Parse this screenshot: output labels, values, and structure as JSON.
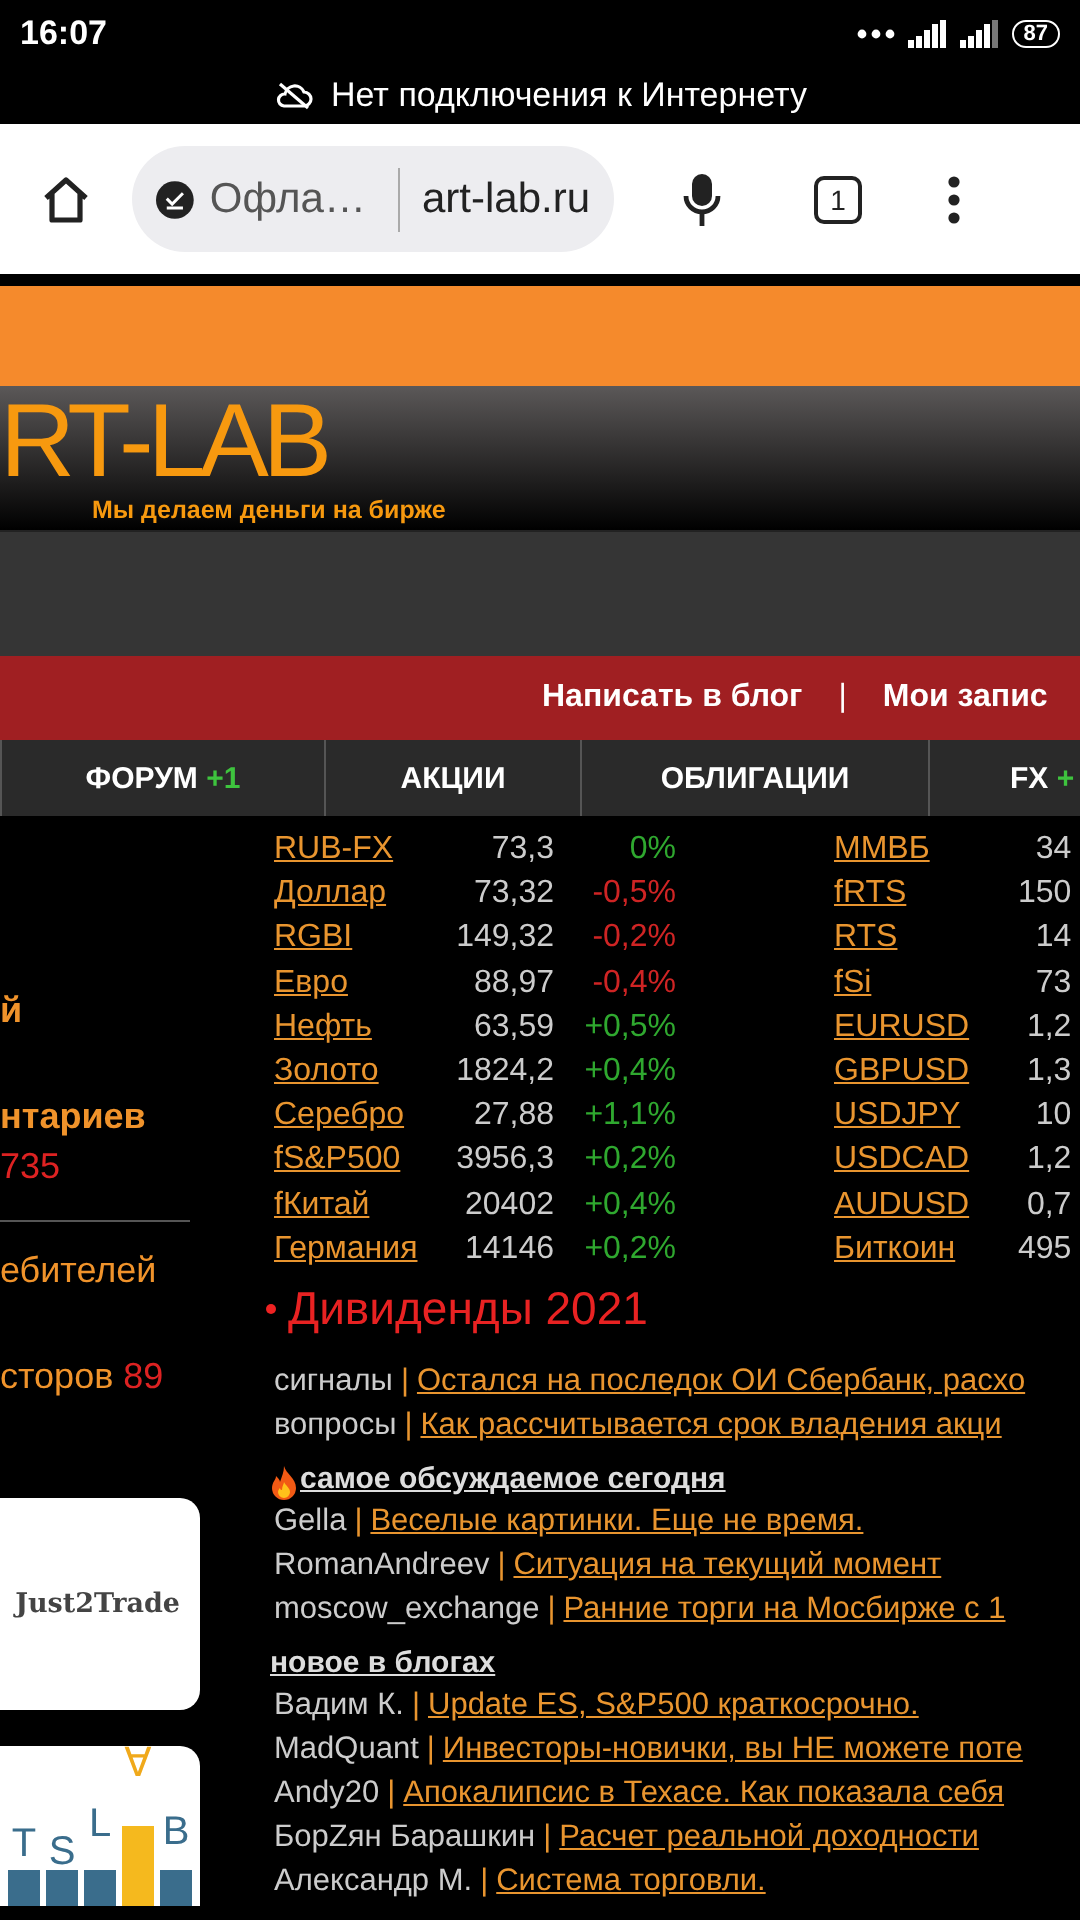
{
  "status_bar": {
    "time": "16:07",
    "battery": "87"
  },
  "offline_banner": {
    "text": "Нет подключения к Интернету"
  },
  "browser": {
    "offline_label": "Офла…",
    "url": "art-lab.ru",
    "tab_count": "1"
  },
  "header": {
    "logo": "RT-LAB",
    "tagline": "Мы делаем деньги на бирже"
  },
  "action_bar": {
    "links": [
      "Написать в блог",
      "Мои запис"
    ],
    "separator": "|"
  },
  "nav": [
    {
      "label": "ФОРУМ",
      "badge": "+1"
    },
    {
      "label": "АКЦИИ"
    },
    {
      "label": "ОБЛИГАЦИИ"
    },
    {
      "label": "FX",
      "badge": "+"
    }
  ],
  "sidebar": [
    {
      "kind": "title",
      "text": "й"
    },
    {
      "kind": "title",
      "text": "нтариев"
    },
    {
      "kind": "count",
      "text": "735"
    },
    {
      "kind": "divider"
    },
    {
      "kind": "stat",
      "text": "ебителей"
    },
    {
      "kind": "stat",
      "text": "сторов",
      "count": "89"
    },
    {
      "kind": "ad",
      "text": "Just2Trade"
    },
    {
      "kind": "logo",
      "letters": [
        "T",
        "S",
        "L",
        "∀",
        "B"
      ]
    }
  ],
  "quotes": [
    {
      "name": "RUB-FX",
      "value": "73,3",
      "change": "0%",
      "color": "#2fa82f"
    },
    {
      "name": "Доллар",
      "value": "73,32",
      "change": "-0,5%",
      "color": "#cf2424"
    },
    {
      "name": "RGBI",
      "value": "149,32",
      "change": "-0,2%",
      "color": "#cf2424"
    },
    {
      "name": "Евро",
      "value": "88,97",
      "change": "-0,4%",
      "color": "#cf2424"
    },
    {
      "name": "Нефть",
      "value": "63,59",
      "change": "+0,5%",
      "color": "#2fa82f"
    },
    {
      "name": "Золото",
      "value": "1824,2",
      "change": "+0,4%",
      "color": "#2fa82f"
    },
    {
      "name": "Серебро",
      "value": "27,88",
      "change": "+1,1%",
      "color": "#2fa82f"
    },
    {
      "name": "fS&P500",
      "value": "3956,3",
      "change": "+0,2%",
      "color": "#2fa82f"
    },
    {
      "name": "fКитай",
      "value": "20402",
      "change": "+0,4%",
      "color": "#2fa82f"
    },
    {
      "name": "Германия",
      "value": "14146",
      "change": "+0,2%",
      "color": "#2fa82f"
    }
  ],
  "quotes_2": [
    {
      "name": "ММВБ",
      "value": "34"
    },
    {
      "name": "fRTS",
      "value": "150"
    },
    {
      "name": "RTS",
      "value": "14"
    },
    {
      "name": "fSi",
      "value": "73"
    },
    {
      "name": "EURUSD",
      "value": "1,2"
    },
    {
      "name": "GBPUSD",
      "value": "1,3"
    },
    {
      "name": "USDJPY",
      "value": "10"
    },
    {
      "name": "USDCAD",
      "value": "1,2"
    },
    {
      "name": "AUDUSD",
      "value": "0,7"
    },
    {
      "name": "Биткоин",
      "value": "495"
    }
  ],
  "dividends_heading": "Дивиденды 2021",
  "feed_separator": "|",
  "feed": [
    {
      "kind": "post",
      "author": "сигналы",
      "title": "Остался на последок ОИ Сбербанк, расхо"
    },
    {
      "kind": "post",
      "author": "вопросы",
      "title": "Как рассчитывается срок владения акци"
    },
    {
      "kind": "hot_heading",
      "title": "самое обсуждаемое сегодня"
    },
    {
      "kind": "post",
      "author": "Gella",
      "title": "Веселые картинки. Еще не время."
    },
    {
      "kind": "post",
      "author": "RomanAndreev",
      "title": "Ситуация на текущий момент"
    },
    {
      "kind": "post",
      "author": "moscow_exchange",
      "title": "Ранние торги на Мосбирже с 1"
    },
    {
      "kind": "heading",
      "title": "новое в блогах"
    },
    {
      "kind": "post",
      "author": "Вадим К.",
      "title": "Update ES, S&P500 краткосрочно."
    },
    {
      "kind": "post",
      "author": "MadQuant",
      "title": "Инвесторы-новички, вы НЕ можете поте"
    },
    {
      "kind": "post",
      "author": "Andy20",
      "title": "Апокалипсис в Техасе. Как показала себя"
    },
    {
      "kind": "post",
      "author": "БорZян Барашкин",
      "title": "Расчет реальной доходности"
    },
    {
      "kind": "post",
      "author": "Александр М.",
      "title": "Система торговли."
    }
  ]
}
